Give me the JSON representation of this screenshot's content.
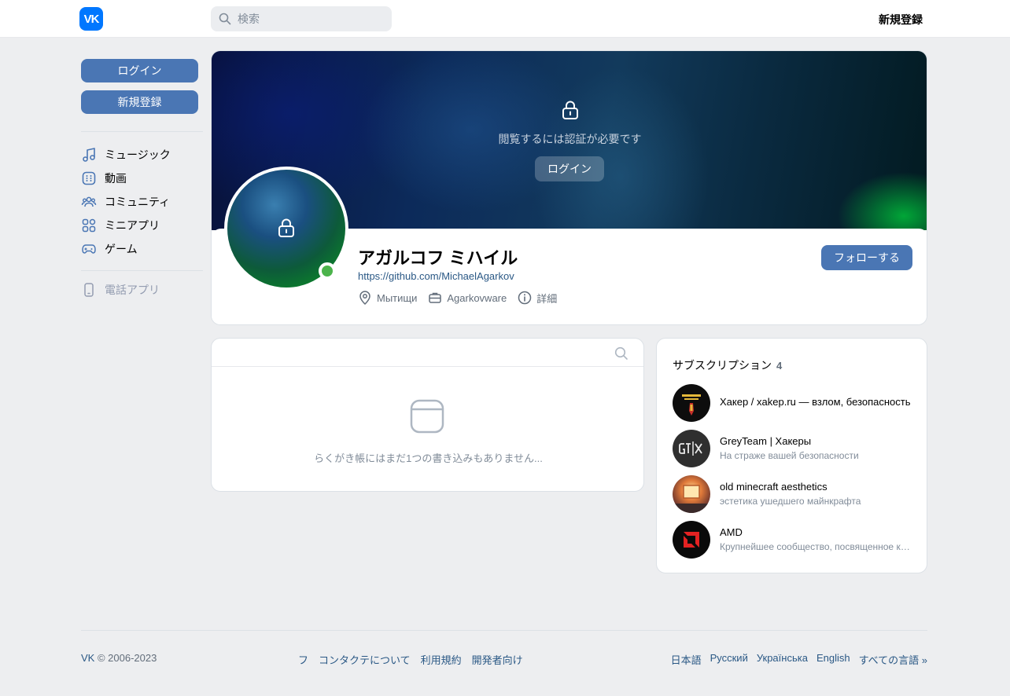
{
  "header": {
    "logo": "VK",
    "search_placeholder": "検索",
    "register": "新規登録"
  },
  "sidebar": {
    "login": "ログイン",
    "register": "新規登録",
    "items": [
      {
        "label": "ミュージック",
        "icon": "music-icon"
      },
      {
        "label": "動画",
        "icon": "video-icon"
      },
      {
        "label": "コミュニティ",
        "icon": "community-icon"
      },
      {
        "label": "ミニアプリ",
        "icon": "mini-apps-icon"
      },
      {
        "label": "ゲーム",
        "icon": "gamepad-icon"
      }
    ],
    "phone_app": "電話アプリ"
  },
  "profile": {
    "cover_text": "閲覧するには認証が必要です",
    "cover_login": "ログイン",
    "name": "アガルコフ ミハイル",
    "link": "https://github.com/MichaelAgarkov",
    "city": "Мытищи",
    "work": "Agarkovware",
    "details": "詳細",
    "follow": "フォローする"
  },
  "wall": {
    "empty_text": "らくがき帳にはまだ1つの書き込みもありません..."
  },
  "subscriptions": {
    "title": "サブスクリプション",
    "count": "4",
    "items": [
      {
        "name": "Хакер / xakep.ru — взлом, безопасность",
        "desc": ""
      },
      {
        "name": "GreyTeam | Хакеры",
        "desc": "На страже вашей безопасности"
      },
      {
        "name": "old minecraft aesthetics",
        "desc": "эстетика ушедшего майнкрафта"
      },
      {
        "name": "AMD",
        "desc": "Крупнейшее сообщество, посвященное компании AMD"
      }
    ]
  },
  "footer": {
    "copyright_brand": "VK",
    "copyright_rest": " © 2006-2023",
    "links": [
      "フ",
      "コンタクテについて",
      "利用規約",
      "開発者向け"
    ],
    "languages": [
      "日本語",
      "Русский",
      "Українська",
      "English",
      "すべての言語 »"
    ]
  },
  "colors": {
    "accent": "#4a76b4",
    "link": "#2a5885",
    "online": "#4bb34b",
    "logo": "#0077ff"
  }
}
